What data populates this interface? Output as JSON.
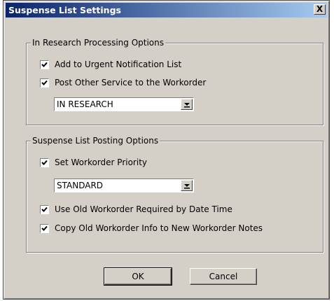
{
  "window": {
    "title": "Suspense List Settings",
    "close_label": "X"
  },
  "research_group": {
    "title": "In Research Processing Options",
    "add_urgent": {
      "label": "Add to Urgent Notification List",
      "checked": true
    },
    "post_other": {
      "label": "Post Other Service to the Workorder",
      "checked": true
    },
    "status_select": {
      "value": "IN RESEARCH"
    }
  },
  "posting_group": {
    "title": "Suspense List Posting Options",
    "set_priority": {
      "label": "Set Workorder Priority",
      "checked": true
    },
    "priority_select": {
      "value": "STANDARD"
    },
    "use_old_required": {
      "label": "Use Old Workorder Required by Date Time",
      "checked": true
    },
    "copy_old_info": {
      "label": "Copy Old Workorder Info to New Workorder Notes",
      "checked": true
    }
  },
  "buttons": {
    "ok": "OK",
    "cancel": "Cancel"
  },
  "icons": {
    "close": "close-icon",
    "checkmark": "checkmark-icon",
    "dropdown": "dropdown-arrow-icon"
  }
}
